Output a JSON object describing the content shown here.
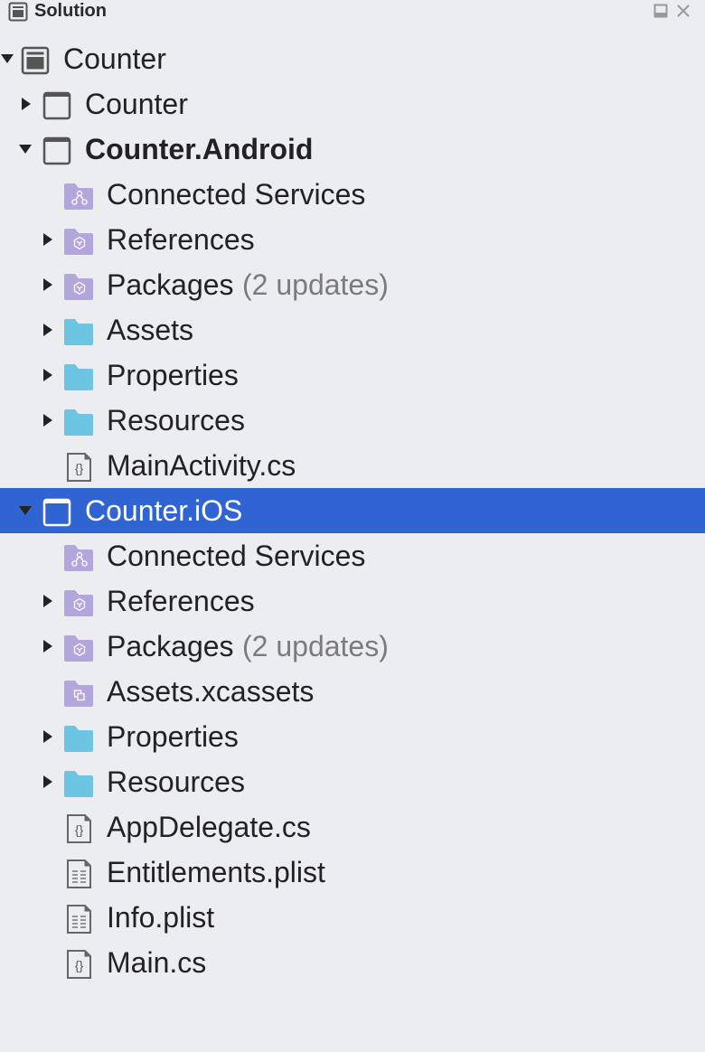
{
  "pad": {
    "title": "Solution",
    "title_icon": "solution-pad-icon",
    "buttons": {
      "maximize": "maximize-icon",
      "close": "close-icon"
    }
  },
  "colors": {
    "background": "#ecedf0",
    "selection": "#3064d3",
    "folder": "#6bc5e3",
    "special_folder": "#b3a6dd",
    "suffix_text": "#7b7b7b"
  },
  "tree": [
    {
      "label": "Counter",
      "level": 0,
      "expander": "expanded",
      "icon": "solution-icon"
    },
    {
      "label": "Counter",
      "level": 1,
      "expander": "collapsed",
      "icon": "project-icon"
    },
    {
      "label": "Counter.Android",
      "level": 1,
      "expander": "expanded",
      "icon": "project-icon",
      "bold": true
    },
    {
      "label": "Connected Services",
      "level": 2,
      "expander": "none",
      "icon": "connected-services-folder-icon"
    },
    {
      "label": "References",
      "level": 2,
      "expander": "collapsed",
      "icon": "references-folder-icon"
    },
    {
      "label": "Packages",
      "suffix": "(2 updates)",
      "level": 2,
      "expander": "collapsed",
      "icon": "packages-folder-icon"
    },
    {
      "label": "Assets",
      "level": 2,
      "expander": "collapsed",
      "icon": "folder-icon"
    },
    {
      "label": "Properties",
      "level": 2,
      "expander": "collapsed",
      "icon": "folder-icon"
    },
    {
      "label": "Resources",
      "level": 2,
      "expander": "collapsed",
      "icon": "folder-icon"
    },
    {
      "label": "MainActivity.cs",
      "level": 2,
      "expander": "none",
      "icon": "csharp-file-icon"
    },
    {
      "label": "Counter.iOS",
      "level": 1,
      "expander": "expanded",
      "icon": "project-icon",
      "selected": true
    },
    {
      "label": "Connected Services",
      "level": 2,
      "expander": "none",
      "icon": "connected-services-folder-icon"
    },
    {
      "label": "References",
      "level": 2,
      "expander": "collapsed",
      "icon": "references-folder-icon"
    },
    {
      "label": "Packages",
      "suffix": "(2 updates)",
      "level": 2,
      "expander": "collapsed",
      "icon": "packages-folder-icon"
    },
    {
      "label": "Assets.xcassets",
      "level": 2,
      "expander": "none",
      "icon": "asset-catalog-folder-icon"
    },
    {
      "label": "Properties",
      "level": 2,
      "expander": "collapsed",
      "icon": "folder-icon"
    },
    {
      "label": "Resources",
      "level": 2,
      "expander": "collapsed",
      "icon": "folder-icon"
    },
    {
      "label": "AppDelegate.cs",
      "level": 2,
      "expander": "none",
      "icon": "csharp-file-icon"
    },
    {
      "label": "Entitlements.plist",
      "level": 2,
      "expander": "none",
      "icon": "plist-file-icon"
    },
    {
      "label": "Info.plist",
      "level": 2,
      "expander": "none",
      "icon": "plist-file-icon"
    },
    {
      "label": "Main.cs",
      "level": 2,
      "expander": "none",
      "icon": "csharp-file-icon"
    }
  ]
}
